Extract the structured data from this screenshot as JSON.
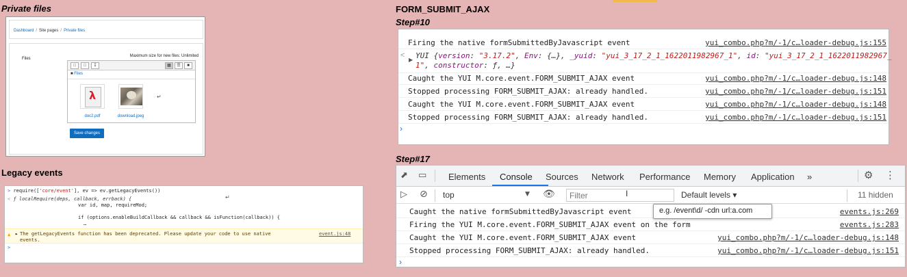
{
  "colors": {
    "background": "#e5b5b6",
    "link": "#0f6cbf",
    "accent": "#1a73e8"
  },
  "private_files": {
    "heading": "Private files",
    "breadcrumb": [
      "Dashboard",
      "Site pages",
      "Private files"
    ],
    "files_label": "Files",
    "max_size": "Maximum size for new files: Unlimited",
    "path": "Files",
    "files": [
      {
        "name": "doc2.pdf",
        "icon": "pdf-icon"
      },
      {
        "name": "download.jpeg",
        "icon": "image-thumbnail"
      }
    ],
    "save_button": "Save changes"
  },
  "legacy_events": {
    "heading": "Legacy events",
    "lines": {
      "l1_a": "require([",
      "l1_b": "'core/event'",
      "l1_c": "], ev => ev.getLegacyEvents())",
      "l2_f": "ƒ",
      "l2_b": " localRequire(deps, callback, errback) {",
      "l3": "var id, map, requireMod;",
      "l4": "if (options.enableBuildCallback && callback && isFunction(callback)) {",
      "l5": "…"
    },
    "warning": "The getLegacyEvents function has been deprecated. Please update your code to use native events.",
    "warning_source": "event.js:48"
  },
  "form_submit": {
    "title": "FORM_SUBMIT_AJAX",
    "step10": "Step#10",
    "step17": "Step#17"
  },
  "step10_console": {
    "rows": [
      {
        "text": "Firing the native formSubmittedByJavascript event",
        "source": "yui_combo.php?m/-1/c…loader-debug.js:155"
      },
      {
        "text": "Caught the YUI M.core.event.FORM_SUBMIT_AJAX event",
        "source": "yui_combo.php?m/-1/c…loader-debug.js:148"
      },
      {
        "text": "Stopped processing FORM_SUBMIT_AJAX: already handled.",
        "source": "yui_combo.php?m/-1/c…loader-debug.js:151"
      },
      {
        "text": "Caught the YUI M.core.event.FORM_SUBMIT_AJAX event",
        "source": "yui_combo.php?m/-1/c…loader-debug.js:148"
      },
      {
        "text": "Stopped processing FORM_SUBMIT_AJAX: already handled.",
        "source": "yui_combo.php?m/-1/c…loader-debug.js:151"
      }
    ],
    "obj": {
      "a": "YUI {",
      "k1": "version",
      "v1": "\"3.17.2\"",
      "k2": "Env",
      "v2": "{…}",
      "k3": "_yuid",
      "v3": "\"yui_3_17_2_1_1622011982967_1\"",
      "k4": "id",
      "v4": "\"yui_3_17_2_1_1622011982967_",
      "c1": "1\"",
      "k5": "constructor",
      "v5": "ƒ, …}"
    }
  },
  "devtools": {
    "tabs": [
      "Elements",
      "Console",
      "Sources",
      "Network",
      "Performance",
      "Memory",
      "Application"
    ],
    "more_tabs": "»",
    "context": "top",
    "filter_placeholder": "Filter",
    "levels": "Default levels ▾",
    "hidden": "11 hidden",
    "tooltip": "e.g. /event\\d/ -cdn url:a.com",
    "rows": [
      {
        "text": "Caught the native formSubmittedByJavascript event",
        "source": "events.js:269"
      },
      {
        "text": "Firing the YUI M.core.event.FORM_SUBMIT_AJAX event on the form",
        "source": "events.js:283"
      },
      {
        "text": "Caught the YUI M.core.event.FORM_SUBMIT_AJAX event",
        "source": "yui_combo.php?m/-1/c…loader-debug.js:148"
      },
      {
        "text": "Stopped processing FORM_SUBMIT_AJAX: already handled.",
        "source": "yui_combo.php?m/-1/c…loader-debug.js:151"
      }
    ]
  }
}
